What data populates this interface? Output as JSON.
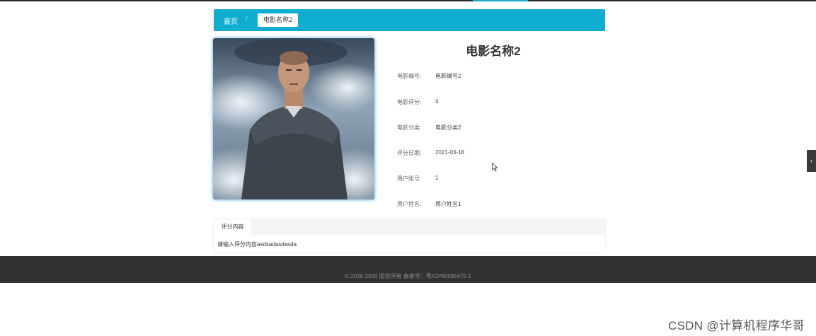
{
  "breadcrumb": {
    "home": "首页",
    "separator": "/",
    "current": "电影名称2"
  },
  "movie": {
    "title": "电影名称2",
    "fields": [
      {
        "label": "电影编号:",
        "value": "电影编号2"
      },
      {
        "label": "电影评分:",
        "value": "4"
      },
      {
        "label": "电影分类:",
        "value": "电影分类2"
      },
      {
        "label": "评分日期:",
        "value": "2021-03-18"
      },
      {
        "label": "用户账号:",
        "value": "1"
      },
      {
        "label": "用户姓名:",
        "value": "用户姓名1"
      }
    ]
  },
  "review": {
    "tab_label": "评分内容",
    "content": "请输入评分内容asdsadasdasda"
  },
  "footer": {
    "copyright": "© 2020-2030 版权所有 备案号：粤ICP65985475-1"
  },
  "watermark": "CSDN @计算机程序华哥",
  "icons": {
    "side_toggle": "chevron-left-icon",
    "cursor": "mouse-pointer-icon"
  },
  "colors": {
    "accent": "#0fadcf",
    "footer_bg": "#323232",
    "topbar": "#2b2b2b"
  }
}
